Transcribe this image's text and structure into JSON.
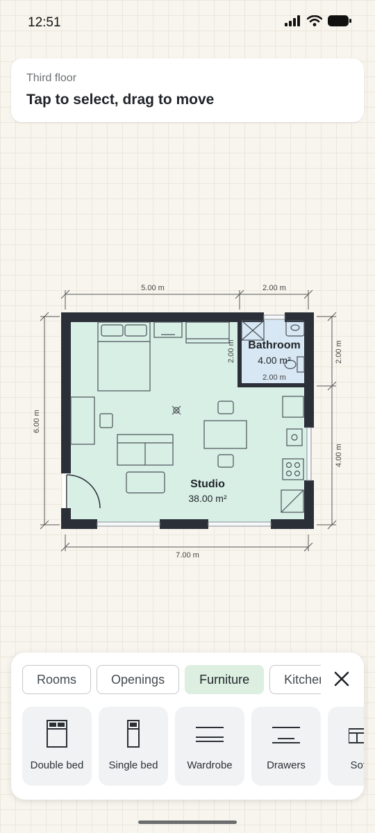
{
  "status": {
    "time": "12:51"
  },
  "header": {
    "subtitle": "Third floor",
    "title": "Tap to select, drag to move"
  },
  "plan": {
    "dims": {
      "top_left": "5.00 m",
      "top_right": "2.00 m",
      "bottom": "7.00 m",
      "left": "6.00 m",
      "right_top": "2.00 m",
      "right_bottom": "4.00 m",
      "bath_inner_v": "2.00 m",
      "bath_inner_h": "2.00 m"
    },
    "rooms": [
      {
        "name": "Bathroom",
        "area": "4.00 m²"
      },
      {
        "name": "Studio",
        "area": "38.00 m²"
      }
    ],
    "colors": {
      "wall": "#2b3038",
      "floor": "#d8efe6",
      "bath_floor": "#d7e7f3"
    }
  },
  "panel": {
    "tabs": [
      {
        "label": "Rooms",
        "active": false
      },
      {
        "label": "Openings",
        "active": false
      },
      {
        "label": "Furniture",
        "active": true
      },
      {
        "label": "Kitchen",
        "active": false
      }
    ],
    "items": [
      {
        "label": "Double bed",
        "icon": "double-bed-icon"
      },
      {
        "label": "Single bed",
        "icon": "single-bed-icon"
      },
      {
        "label": "Wardrobe",
        "icon": "wardrobe-icon"
      },
      {
        "label": "Drawers",
        "icon": "drawers-icon"
      },
      {
        "label": "Sofa,",
        "icon": "sofa-icon"
      }
    ]
  }
}
